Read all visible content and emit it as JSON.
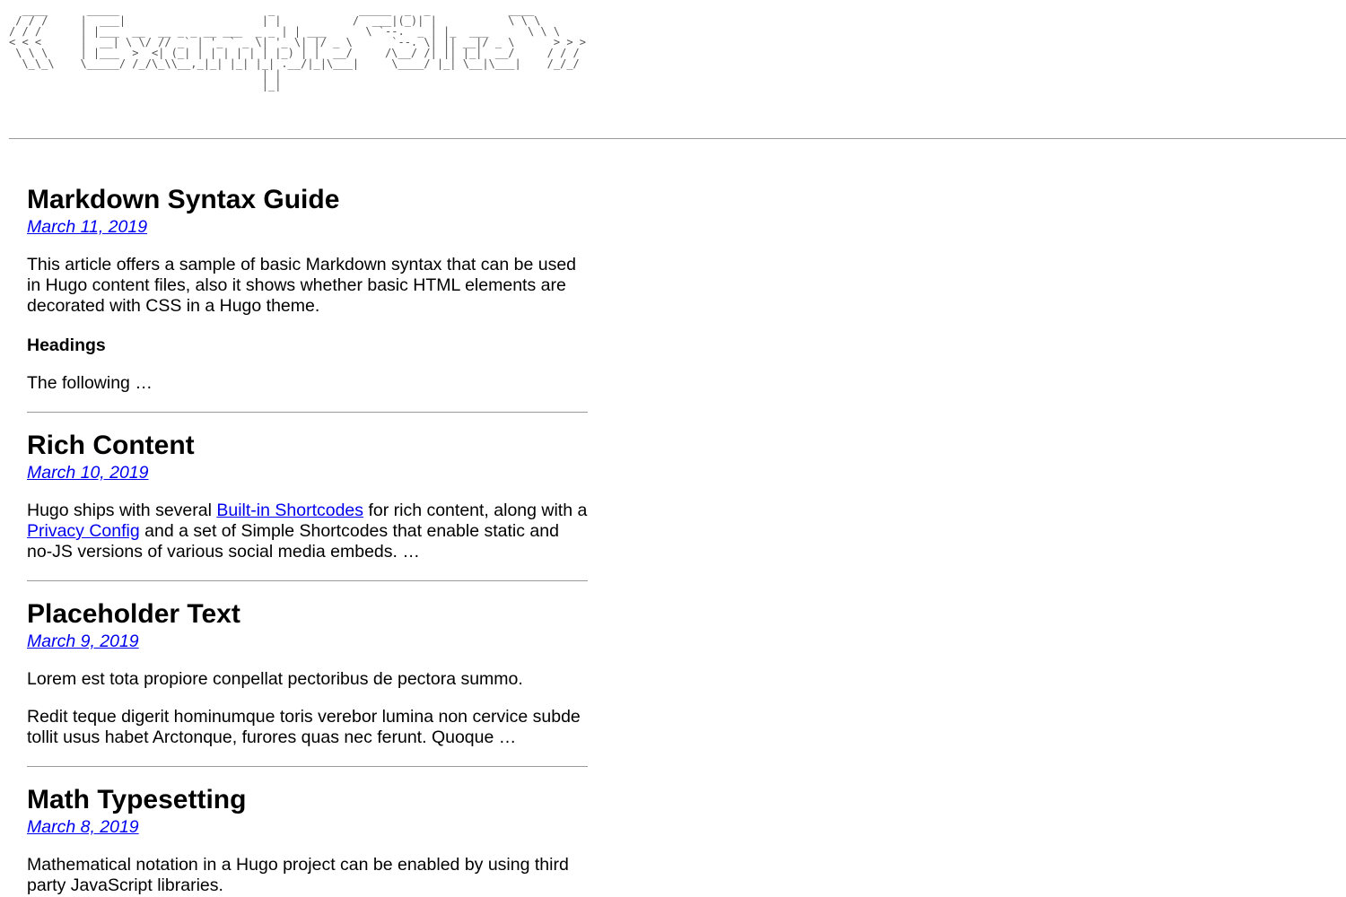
{
  "site": {
    "logo_ascii": "  ____      _____                       _             _____  _  _            ____\n / / /     |  ___|                     | |           /  ___|(_)| |           \\ \\ \\\n/ / /      | |___  __  __ _ _ __ ___  _ _ | | ___      \\ `--.  _ | |_  ___      \\ \\ \\\n< < <      |  __| \\ \\/ // _` | '_ ` _ \\| '_ \\| |/ _ \\      `--. \\| || __|/ _ \\      > > >\n \\ \\ \\     | |___  >  <| (_| | | | | | | |_) | |  __/     /\\__/ /| || |_|  __/     / / /\n  \\_\\_\\    \\_____/ /_/\\_\\\\__,_|_| |_| |_| .__/|_|\\___|     \\____/ |_| \\__|\\___|    /_/_/\n                                       | |\n                                       |_|",
    "logo_alt": "Example Site"
  },
  "posts": [
    {
      "title": "Markdown Syntax Guide",
      "date": "March 11, 2019",
      "summary": [
        {
          "type": "p",
          "text": "This article offers a sample of basic Markdown syntax that can be used in Hugo content files, also it shows whether basic HTML elements are decorated with CSS in a Hugo theme."
        },
        {
          "type": "h4",
          "text": "Headings"
        },
        {
          "type": "p",
          "text": "The following …"
        }
      ]
    },
    {
      "title": "Rich Content",
      "date": "March 10, 2019",
      "summary_parts": {
        "t1": "Hugo ships with several ",
        "link1": "Built-in Shortcodes",
        "t2": " for rich content, along with a ",
        "link2": "Privacy Config",
        "t3": " and a set of Simple Shortcodes that enable static and no-JS versions of various social media embeds. …"
      }
    },
    {
      "title": "Placeholder Text",
      "date": "March 9, 2019",
      "summary": [
        {
          "type": "p",
          "text": "Lorem est tota propiore conpellat pectoribus de pectora summo."
        },
        {
          "type": "p",
          "text": "Redit teque digerit hominumque toris verebor lumina non cervice subde tollit usus habet Arctonque, furores quas nec ferunt. Quoque …"
        }
      ]
    },
    {
      "title": "Math Typesetting",
      "date": "March 8, 2019",
      "summary": [
        {
          "type": "p",
          "text": "Mathematical notation in a Hugo project can be enabled by using third party JavaScript libraries."
        }
      ]
    }
  ]
}
